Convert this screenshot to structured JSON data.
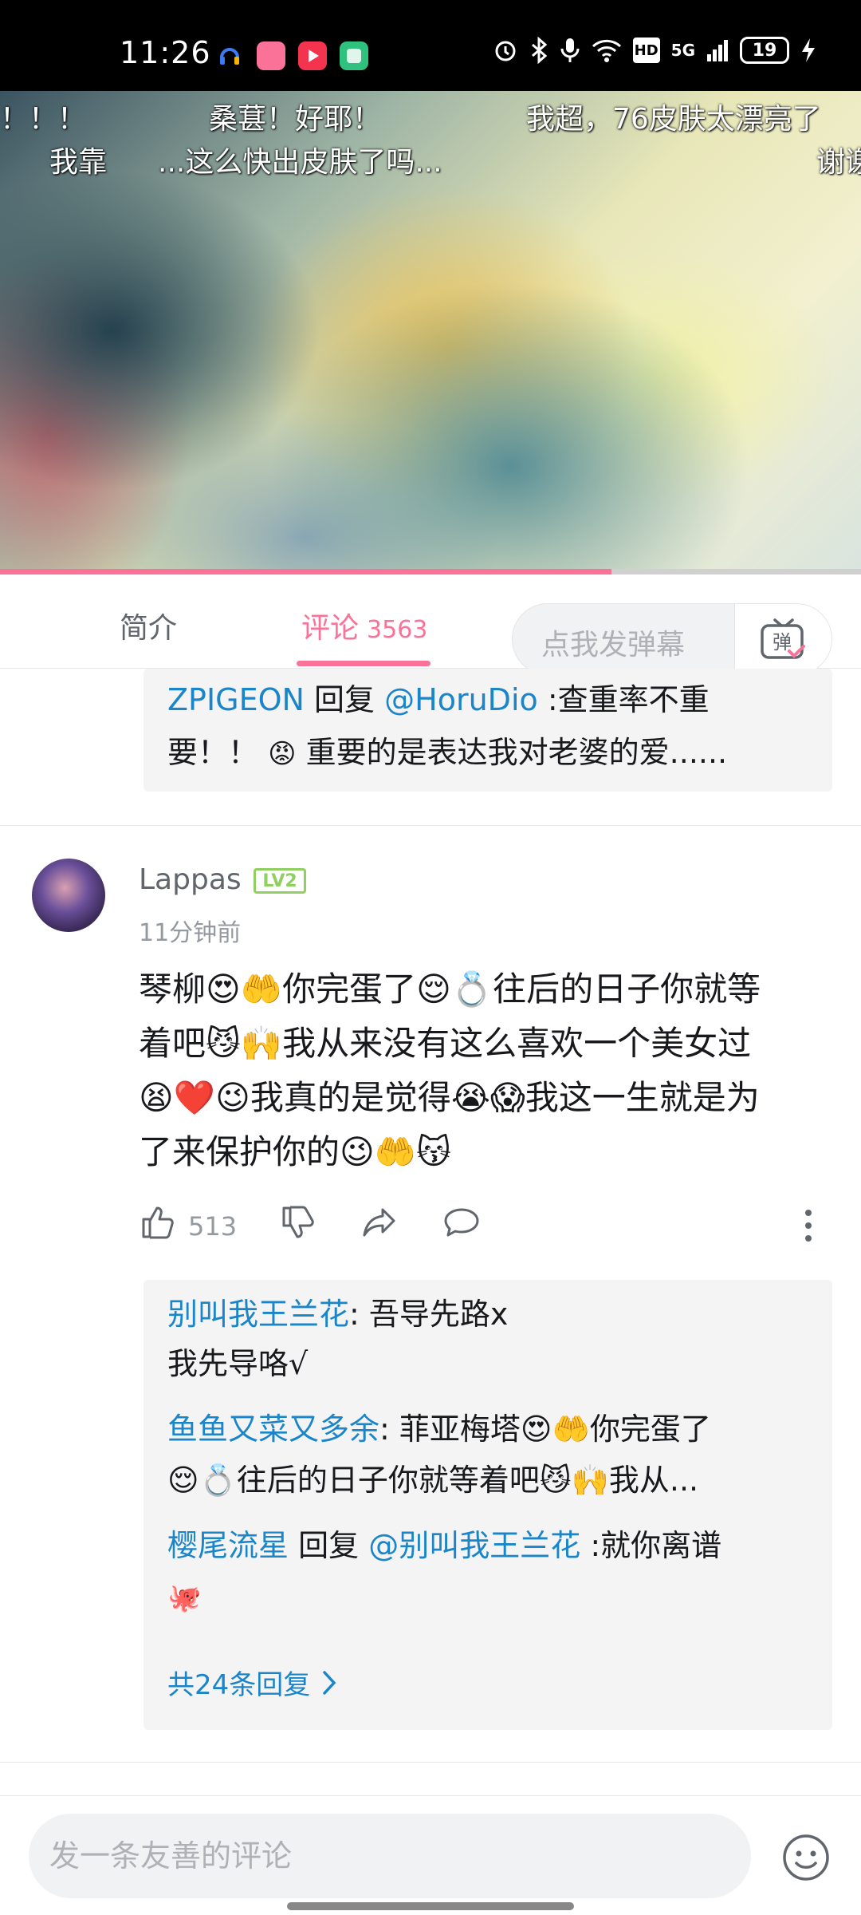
{
  "status_bar": {
    "time": "11:26",
    "network": "5G",
    "battery": "19",
    "apps": [
      "headset-app-icon",
      "bilibili-app-icon",
      "video-app-icon",
      "green-app-icon"
    ],
    "colors": {
      "bilibili": "#fb7299",
      "video": "#f4334f",
      "green": "#2ec27e",
      "headset": "#3b7bf6"
    }
  },
  "video": {
    "progress": 0.71,
    "danmaku": [
      "！！！",
      "桑葚！好耶！",
      "我超，76皮肤太漂亮了",
      "我靠",
      "...这么快出皮肤了吗...",
      "谢谢"
    ]
  },
  "tabs": {
    "intro": "简介",
    "comments": "评论",
    "comments_count": "3563",
    "danmaku_placeholder": "点我发弹幕",
    "danmaku_button": "弹"
  },
  "prev_reply": {
    "user": "ZPIGEON",
    "reply_word": "回复",
    "target": "@HoruDio",
    "line1": ":查重率不重",
    "line2a": "要！！",
    "emoji": "😡",
    "line2b": "重要的是表达我对老婆的爱......"
  },
  "comment": {
    "username": "Lappas",
    "level": "LV2",
    "time": "11分钟前",
    "lines": [
      "琴柳😍🤲你完蛋了😌💍往后的日子你就等",
      "着吧😼🙌我从来没有这么喜欢一个美女过",
      "😫❤️😉我真的是觉得😭😱我这一生就是为",
      "了来保护你的😉🤲😽"
    ],
    "likes": "513"
  },
  "replies": [
    {
      "user": "别叫我王兰花",
      "text1": ": 吾导先路x",
      "text2": "我先导咯√"
    },
    {
      "user": "鱼鱼又菜又多余",
      "text1": ": 菲亚梅塔😍🤲你完蛋了",
      "text2": "😌💍往后的日子你就等着吧😼🙌我从..."
    },
    {
      "user": "樱尾流星",
      "reply_word": "回复",
      "target": "@别叫我王兰花",
      "text1": ":就你离谱",
      "text2": "🐙"
    }
  ],
  "more_replies": "共24条回复",
  "bottom": {
    "placeholder": "发一条友善的评论"
  }
}
